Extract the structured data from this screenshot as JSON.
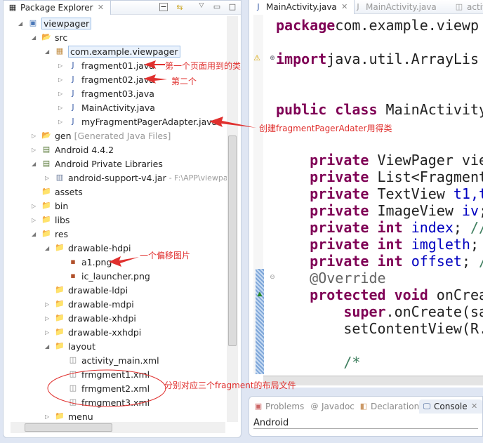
{
  "package_explorer": {
    "title": "Package Explorer",
    "tree": [
      {
        "label": "viewpager",
        "level": 0,
        "toggle": "open",
        "icon": "project-icon",
        "selected": true
      },
      {
        "label": "src",
        "level": 1,
        "toggle": "open",
        "icon": "source-folder-icon"
      },
      {
        "label": "com.example.viewpager",
        "level": 2,
        "toggle": "open",
        "icon": "package-icon",
        "selected": true
      },
      {
        "label": "fragment01.java",
        "level": 3,
        "toggle": "closed",
        "icon": "java-file-icon"
      },
      {
        "label": "fragment02.java",
        "level": 3,
        "toggle": "closed",
        "icon": "java-file-icon"
      },
      {
        "label": "fragment03.java",
        "level": 3,
        "toggle": "closed",
        "icon": "java-file-icon"
      },
      {
        "label": "MainActivity.java",
        "level": 3,
        "toggle": "closed",
        "icon": "java-file-warning-icon"
      },
      {
        "label": "myFragmentPagerAdapter.java",
        "level": 3,
        "toggle": "closed",
        "icon": "java-file-warning-icon"
      },
      {
        "label": "gen",
        "level": 1,
        "toggle": "closed",
        "icon": "source-folder-icon",
        "decoration": "[Generated Java Files]"
      },
      {
        "label": "Android 4.4.2",
        "level": 1,
        "toggle": "closed",
        "icon": "library-icon"
      },
      {
        "label": "Android Private Libraries",
        "level": 1,
        "toggle": "open",
        "icon": "library-icon"
      },
      {
        "label": "android-support-v4.jar",
        "level": 2,
        "toggle": "closed",
        "icon": "jar-icon",
        "decoration": "- F:\\APP\\viewpa"
      },
      {
        "label": "assets",
        "level": 1,
        "toggle": "none",
        "icon": "folder-icon"
      },
      {
        "label": "bin",
        "level": 1,
        "toggle": "closed",
        "icon": "folder-icon"
      },
      {
        "label": "libs",
        "level": 1,
        "toggle": "closed",
        "icon": "folder-icon"
      },
      {
        "label": "res",
        "level": 1,
        "toggle": "open",
        "icon": "folder-icon"
      },
      {
        "label": "drawable-hdpi",
        "level": 2,
        "toggle": "open",
        "icon": "folder-icon"
      },
      {
        "label": "a1.png",
        "level": 3,
        "toggle": "none",
        "icon": "image-file-icon"
      },
      {
        "label": "ic_launcher.png",
        "level": 3,
        "toggle": "none",
        "icon": "image-file-icon"
      },
      {
        "label": "drawable-ldpi",
        "level": 2,
        "toggle": "none",
        "icon": "folder-icon"
      },
      {
        "label": "drawable-mdpi",
        "level": 2,
        "toggle": "closed",
        "icon": "folder-icon"
      },
      {
        "label": "drawable-xhdpi",
        "level": 2,
        "toggle": "closed",
        "icon": "folder-icon"
      },
      {
        "label": "drawable-xxhdpi",
        "level": 2,
        "toggle": "closed",
        "icon": "folder-icon"
      },
      {
        "label": "layout",
        "level": 2,
        "toggle": "open",
        "icon": "folder-icon"
      },
      {
        "label": "activity_main.xml",
        "level": 3,
        "toggle": "none",
        "icon": "xml-file-icon"
      },
      {
        "label": "frmgment1.xml",
        "level": 3,
        "toggle": "none",
        "icon": "xml-file-icon"
      },
      {
        "label": "frmgment2.xml",
        "level": 3,
        "toggle": "none",
        "icon": "xml-file-icon"
      },
      {
        "label": "frmgment3.xml",
        "level": 3,
        "toggle": "none",
        "icon": "xml-file-icon"
      },
      {
        "label": "menu",
        "level": 2,
        "toggle": "closed",
        "icon": "folder-icon"
      }
    ]
  },
  "editor": {
    "tabs": [
      {
        "label": "MainActivity.java",
        "active": true
      },
      {
        "label": "MainActivity.java",
        "active": false
      },
      {
        "label": "activi",
        "active": false
      }
    ],
    "lines": [
      [
        [
          "kw",
          "package"
        ],
        [
          "",
          "com.example.viewp"
        ]
      ],
      [],
      [
        [
          "kw",
          "import"
        ],
        [
          "",
          "java.util.ArrayLis"
        ]
      ],
      [],
      [],
      [
        [
          "kw",
          "public"
        ],
        [
          "",
          " "
        ],
        [
          "kw",
          "class"
        ],
        [
          "",
          " MainActivity"
        ]
      ],
      [],
      [],
      [
        [
          "",
          "    "
        ],
        [
          "kw",
          "private"
        ],
        [
          "",
          " ViewPager vie"
        ]
      ],
      [
        [
          "",
          "    "
        ],
        [
          "kw",
          "private"
        ],
        [
          "",
          " List<Fragment"
        ]
      ],
      [
        [
          "",
          "    "
        ],
        [
          "kw",
          "private"
        ],
        [
          "",
          " TextView "
        ],
        [
          "fld",
          "t1,t"
        ]
      ],
      [
        [
          "",
          "    "
        ],
        [
          "kw",
          "private"
        ],
        [
          "",
          " ImageView "
        ],
        [
          "fld",
          "iv"
        ],
        [
          "",
          ";"
        ]
      ],
      [
        [
          "",
          "    "
        ],
        [
          "kw",
          "private"
        ],
        [
          "",
          " "
        ],
        [
          "kw",
          "int"
        ],
        [
          "",
          " "
        ],
        [
          "fld",
          "index"
        ],
        [
          "",
          "; "
        ],
        [
          "cm",
          "//"
        ]
      ],
      [
        [
          "",
          "    "
        ],
        [
          "kw",
          "private"
        ],
        [
          "",
          " "
        ],
        [
          "kw",
          "int"
        ],
        [
          "",
          " "
        ],
        [
          "fld",
          "imgleth"
        ],
        [
          "",
          ";"
        ]
      ],
      [
        [
          "",
          "    "
        ],
        [
          "kw",
          "private"
        ],
        [
          "",
          " "
        ],
        [
          "kw",
          "int"
        ],
        [
          "",
          " "
        ],
        [
          "fld",
          "offset"
        ],
        [
          "",
          "; "
        ],
        [
          "cm",
          "/"
        ]
      ],
      [
        [
          "",
          "    "
        ],
        [
          "ann",
          "@Override"
        ]
      ],
      [
        [
          "",
          "    "
        ],
        [
          "kw",
          "protected"
        ],
        [
          "",
          " "
        ],
        [
          "kw",
          "void"
        ],
        [
          "",
          " onCrea"
        ]
      ],
      [
        [
          "",
          "        "
        ],
        [
          "kw",
          "super"
        ],
        [
          "",
          ".onCreate(sa"
        ]
      ],
      [
        [
          "",
          "        "
        ],
        [
          "",
          "setContentView(R."
        ]
      ],
      [],
      [
        [
          "",
          "        "
        ],
        [
          "cm",
          "/*"
        ]
      ]
    ]
  },
  "bottom_panel": {
    "tabs": [
      "Problems",
      "Javadoc",
      "Declaration",
      "Console"
    ],
    "active": "Console",
    "console_text": "Android"
  },
  "annotations": {
    "fragment01": "第一个页面用到的类",
    "fragment02": "第二个",
    "adapter": "创建fragmentPagerAdater用得类",
    "a1": "一个偏移图片",
    "layouts": "分别对应三个fragment的布局文件"
  },
  "colors": {
    "annotation": "#e0302e",
    "keyword": "#7f0055",
    "field": "#0000c0"
  }
}
